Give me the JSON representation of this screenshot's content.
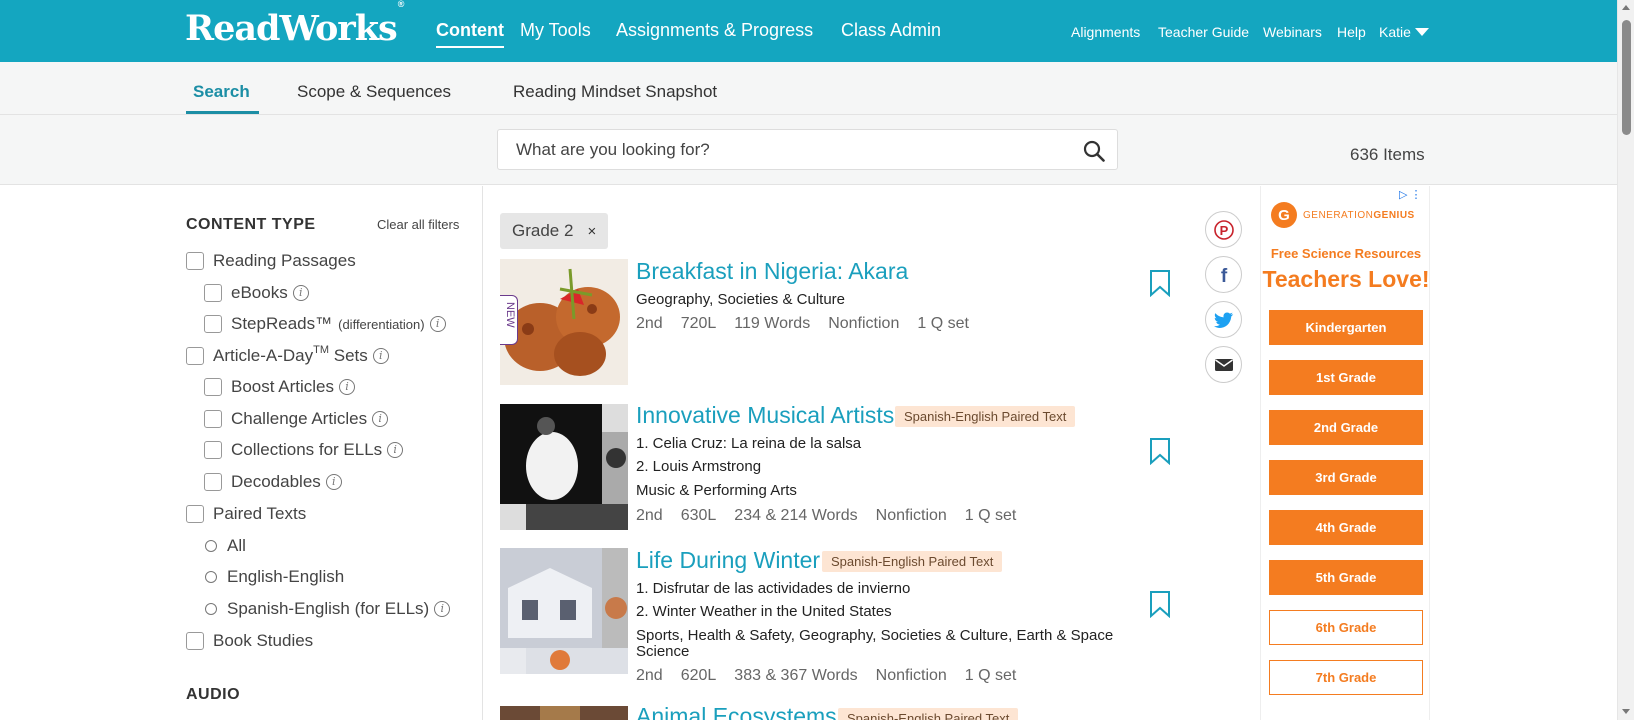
{
  "header": {
    "logo": "ReadWorks",
    "logo_mark": "®",
    "nav": [
      "Content",
      "My Tools",
      "Assignments & Progress",
      "Class Admin"
    ],
    "right_links": [
      "Alignments",
      "Teacher Guide",
      "Webinars",
      "Help"
    ],
    "user": "Katie"
  },
  "subnav": {
    "tabs": [
      "Search",
      "Scope & Sequences",
      "Reading Mindset Snapshot"
    ],
    "active": "Search"
  },
  "search": {
    "placeholder": "What are you looking for?",
    "items_count": "636 Items"
  },
  "filters": {
    "content_type_heading": "CONTENT TYPE",
    "clear_all": "Clear all filters",
    "reading_passages": "Reading Passages",
    "ebooks": "eBooks",
    "stepreads": "StepReads™",
    "stepreads_note": "(differentiation)",
    "article_a_day": "Article-A-Day",
    "article_a_day_tm": "TM",
    "article_a_day_suffix": "Sets",
    "boost": "Boost Articles",
    "challenge": "Challenge Articles",
    "collections": "Collections for ELLs",
    "decodables": "Decodables",
    "paired_texts": "Paired Texts",
    "paired_all": "All",
    "paired_english": "English-English",
    "paired_spanish": "Spanish-English (for ELLs)",
    "book_studies": "Book Studies",
    "audio_heading": "AUDIO"
  },
  "active_filter": {
    "label": "Grade 2",
    "remove": "×"
  },
  "results": [
    {
      "title": "Breakfast in Nigeria: Akara",
      "badge": "",
      "new_tag": "NEW",
      "subtitles": [],
      "topics": "Geography, Societies & Culture",
      "meta": [
        "2nd",
        "720L",
        "119 Words",
        "Nonfiction",
        "1 Q set"
      ]
    },
    {
      "title": "Innovative Musical Artists",
      "badge": "Spanish-English Paired Text",
      "subtitles": [
        "1. Celia Cruz: La reina de la salsa",
        "2. Louis Armstrong"
      ],
      "topics": "Music & Performing Arts",
      "meta": [
        "2nd",
        "630L",
        "234 & 214 Words",
        "Nonfiction",
        "1 Q set"
      ]
    },
    {
      "title": "Life During Winter",
      "badge": "Spanish-English Paired Text",
      "subtitles": [
        "1. Disfrutar de las actividades de invierno",
        "2. Winter Weather in the United States"
      ],
      "topics_line1": "Sports, Health & Safety, Geography, Societies & Culture, Earth & Space",
      "topics_line2": "Science",
      "meta": [
        "2nd",
        "620L",
        "383 & 367 Words",
        "Nonfiction",
        "1 Q set"
      ]
    },
    {
      "title": "Animal Ecosystems",
      "badge": "Spanish-English Paired Text"
    }
  ],
  "share": [
    "pinterest-icon",
    "facebook-icon",
    "twitter-icon",
    "email-icon"
  ],
  "ad": {
    "brand_part1": "GENERATION",
    "brand_part2": "GENIUS",
    "subhead": "Free Science Resources",
    "headline": "Teachers Love!",
    "buttons": [
      "Kindergarten",
      "1st Grade",
      "2nd Grade",
      "3rd Grade",
      "4th Grade",
      "5th Grade",
      "6th Grade",
      "7th Grade"
    ]
  },
  "colors": {
    "brand_teal": "#14a6c0",
    "link_blue": "#1a9fbd",
    "ad_orange": "#f47c20",
    "badge_bg": "#fde5d3"
  }
}
